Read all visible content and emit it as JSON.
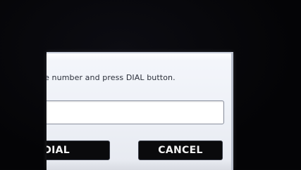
{
  "dialog": {
    "instruction": "pe number and press DIAL button.",
    "number_field_value": "",
    "dial_label": "DIAL",
    "cancel_label": "CANCEL"
  },
  "colors": {
    "background": "#050507",
    "dialog_bg": "#eef1f7",
    "button_bg": "#0a0a0c",
    "button_text": "#f2f2f2",
    "instruction_text": "#2a2e3a"
  }
}
